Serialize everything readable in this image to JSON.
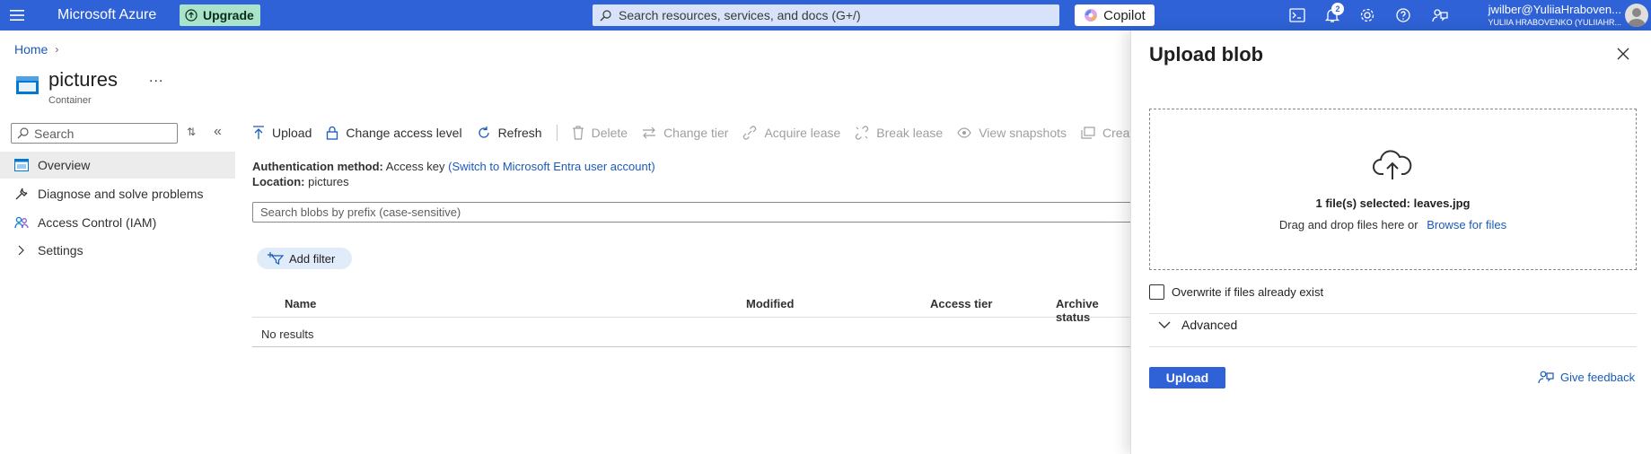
{
  "topbar": {
    "brand": "Microsoft Azure",
    "upgrade_label": "Upgrade",
    "search_placeholder": "Search resources, services, and docs (G+/)",
    "copilot_label": "Copilot",
    "notification_count": "2",
    "user_email": "jwilber@YuliiaHraboven...",
    "user_directory": "YULIIA HRABOVENKO (YULIIAHR..."
  },
  "breadcrumb": {
    "home": "Home"
  },
  "resource": {
    "title": "pictures",
    "subtitle": "Container",
    "more": "..."
  },
  "nav": {
    "search_placeholder": "Search",
    "items": [
      {
        "label": "Overview",
        "icon": "overview-icon",
        "selected": true
      },
      {
        "label": "Diagnose and solve problems",
        "icon": "wrench-icon"
      },
      {
        "label": "Access Control (IAM)",
        "icon": "people-icon"
      },
      {
        "label": "Settings",
        "icon": "chevron-right-icon"
      }
    ]
  },
  "toolbar": {
    "upload": "Upload",
    "change_access_level": "Change access level",
    "refresh": "Refresh",
    "delete": "Delete",
    "change_tier": "Change tier",
    "acquire_lease": "Acquire lease",
    "break_lease": "Break lease",
    "view_snapshots": "View snapshots",
    "create_snapshot": "Create snapsh"
  },
  "info": {
    "auth_label": "Authentication method:",
    "auth_value": "Access key",
    "auth_link": "(Switch to Microsoft Entra user account)",
    "location_label": "Location:",
    "location_value": "pictures"
  },
  "blob_search_placeholder": "Search blobs by prefix (case-sensitive)",
  "add_filter": "Add filter",
  "grid": {
    "columns": [
      "Name",
      "Modified",
      "Access tier",
      "Archive status"
    ],
    "empty": "No results"
  },
  "panel": {
    "title": "Upload blob",
    "selected_text": "1 file(s) selected: leaves.jpg",
    "drag_text": "Drag and drop files here",
    "or_text": "or",
    "browse_link": "Browse for files",
    "overwrite_label": "Overwrite if files already exist",
    "advanced_label": "Advanced",
    "upload_button": "Upload",
    "feedback_link": "Give feedback"
  },
  "colors": {
    "topbar": "#2f62d6",
    "link": "#1a5ab8",
    "upgrade": "#a9e3c9"
  }
}
